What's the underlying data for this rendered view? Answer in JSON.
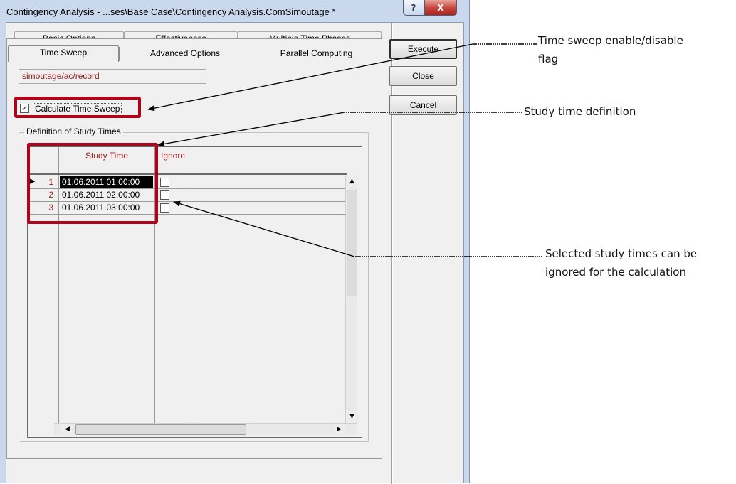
{
  "window": {
    "title": "Contingency Analysis - ...ses\\Base Case\\Contingency Analysis.ComSimoutage *",
    "help_glyph": "?",
    "close_glyph": "X"
  },
  "tabs": {
    "row1": [
      "Basic Options",
      "Effectiveness",
      "Multiple Time Phases"
    ],
    "row2": [
      "Time Sweep",
      "Advanced Options",
      "Parallel Computing"
    ],
    "active": "Time Sweep"
  },
  "buttons": {
    "execute": "Execute",
    "close": "Close",
    "cancel": "Cancel"
  },
  "path_field": {
    "value": "simoutage/ac/record"
  },
  "time_sweep": {
    "label": "Calculate Time Sweep",
    "checked": true,
    "check_glyph": "✓"
  },
  "study_times": {
    "group_title": "Definition of Study Times",
    "columns": [
      "Study Time",
      "Ignore"
    ],
    "rows": [
      {
        "num": "1",
        "time": "01.06.2011 01:00:00",
        "ignore": false,
        "selected": true
      },
      {
        "num": "2",
        "time": "01.06.2011 02:00:00",
        "ignore": false,
        "selected": false
      },
      {
        "num": "3",
        "time": "01.06.2011 03:00:00",
        "ignore": false,
        "selected": false
      }
    ],
    "current_row_marker": "▶"
  },
  "annotations": {
    "time_sweep_flag": [
      "Time sweep enable/disable",
      "flag"
    ],
    "study_time_def": "Study time definition",
    "ignore_note": [
      "Selected study times can be",
      "ignored for the calculation"
    ]
  },
  "colors": {
    "highlight": "#b3001b",
    "header_text": "#9b1b1b",
    "path_text": "#8b1c1c"
  }
}
